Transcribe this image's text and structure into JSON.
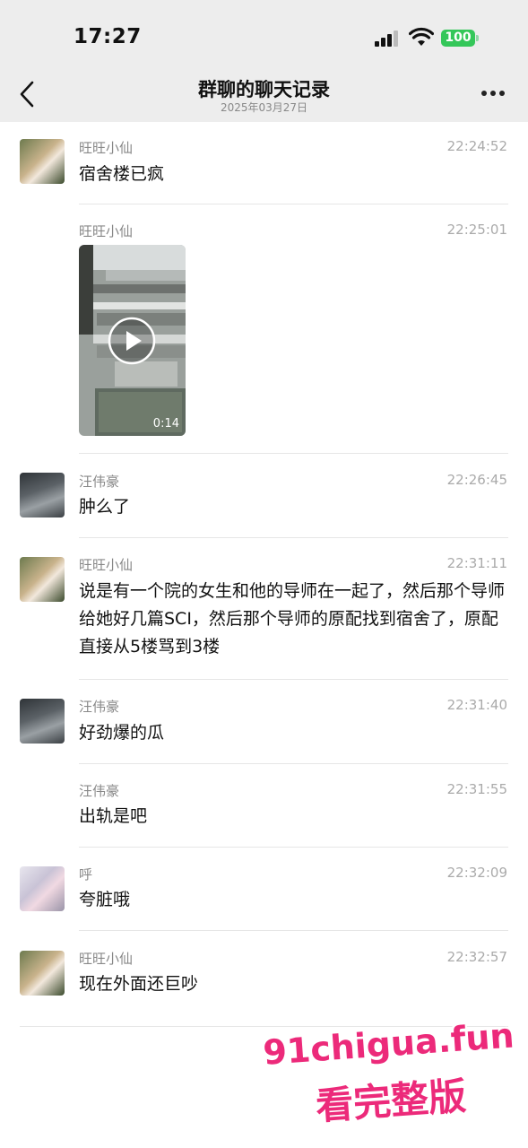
{
  "status_bar": {
    "time": "17:27",
    "battery": "100"
  },
  "nav": {
    "title": "群聊的聊天记录",
    "date": "2025年03月27日"
  },
  "messages": [
    {
      "sender": "旺旺小仙",
      "time": "22:24:52",
      "text": "宿舍楼已疯",
      "avatar": "avatar-a"
    },
    {
      "sender": "旺旺小仙",
      "time": "22:25:01",
      "video_duration": "0:14"
    },
    {
      "sender": "汪伟豪",
      "time": "22:26:45",
      "text": "肿么了",
      "avatar": "avatar-b"
    },
    {
      "sender": "旺旺小仙",
      "time": "22:31:11",
      "text": "说是有一个院的女生和他的导师在一起了，然后那个导师给她好几篇SCI，然后那个导师的原配找到宿舍了，原配直接从5楼骂到3楼",
      "avatar": "avatar-a"
    },
    {
      "sender": "汪伟豪",
      "time": "22:31:40",
      "text": "好劲爆的瓜",
      "avatar": "avatar-b"
    },
    {
      "sender": "汪伟豪",
      "time": "22:31:55",
      "text": "出轨是吧"
    },
    {
      "sender": "呼",
      "time": "22:32:09",
      "text": "夸脏哦",
      "avatar": "avatar-c"
    },
    {
      "sender": "旺旺小仙",
      "time": "22:32:57",
      "text": "现在外面还巨吵",
      "avatar": "avatar-a"
    }
  ],
  "watermark": {
    "line1": "91chigua.fun",
    "line2": "看完整版"
  }
}
